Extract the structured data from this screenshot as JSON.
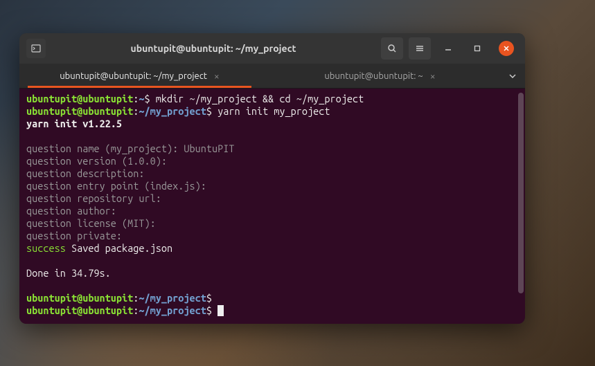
{
  "window": {
    "title": "ubuntupit@ubuntupit: ~/my_project"
  },
  "tabs": [
    {
      "label": "ubuntupit@ubuntupit: ~/my_project",
      "active": true
    },
    {
      "label": "ubuntupit@ubuntupit: ~",
      "active": false
    }
  ],
  "prompt": {
    "user_host": "ubuntupit@ubuntupit",
    "home_path": "~",
    "project_path": "~/my_project",
    "sep": ":",
    "symbol": "$"
  },
  "commands": {
    "cmd1": " mkdir ~/my_project && cd ~/my_project",
    "cmd2": " yarn init my_project"
  },
  "output": {
    "yarn_init": "yarn init v1.22.5",
    "q_name": "question name (my_project): UbuntuPIT",
    "q_version": "question version (1.0.0):",
    "q_description": "question description:",
    "q_entry": "question entry point (index.js):",
    "q_repo": "question repository url:",
    "q_author": "question author:",
    "q_license": "question license (MIT):",
    "q_private": "question private:",
    "success_kw": "success",
    "success_msg": " Saved package.json",
    "done": "Done in 34.79s."
  }
}
